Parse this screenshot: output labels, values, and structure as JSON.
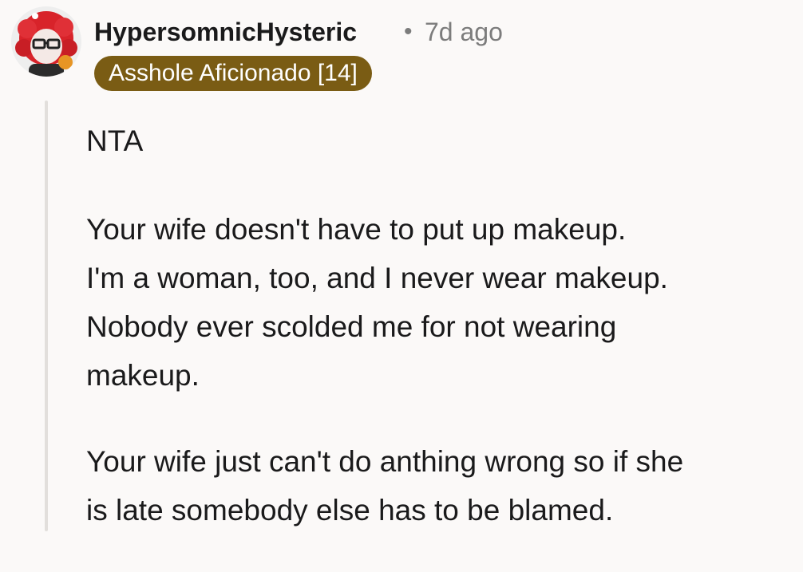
{
  "comment": {
    "avatar_icon": "user-avatar-icon",
    "username": "HypersomnicHysteric",
    "separator": "•",
    "timestamp": "7d ago",
    "flair": "Asshole Aficionado [14]",
    "paragraphs": [
      "NTA",
      "Your wife doesn't have to put up makeup.\nI'm a woman, too, and I never wear makeup.\nNobody ever scolded me for not wearing\nmakeup.",
      "Your wife just can't do anthing wrong so if she\nis late somebody else has to be blamed."
    ]
  },
  "colors": {
    "background": "#fbf9f8",
    "flair_background": "#7a5c14",
    "flair_text": "#ffffff",
    "meta_text": "#7c7c7c",
    "thread_line": "#e2dfdc"
  }
}
